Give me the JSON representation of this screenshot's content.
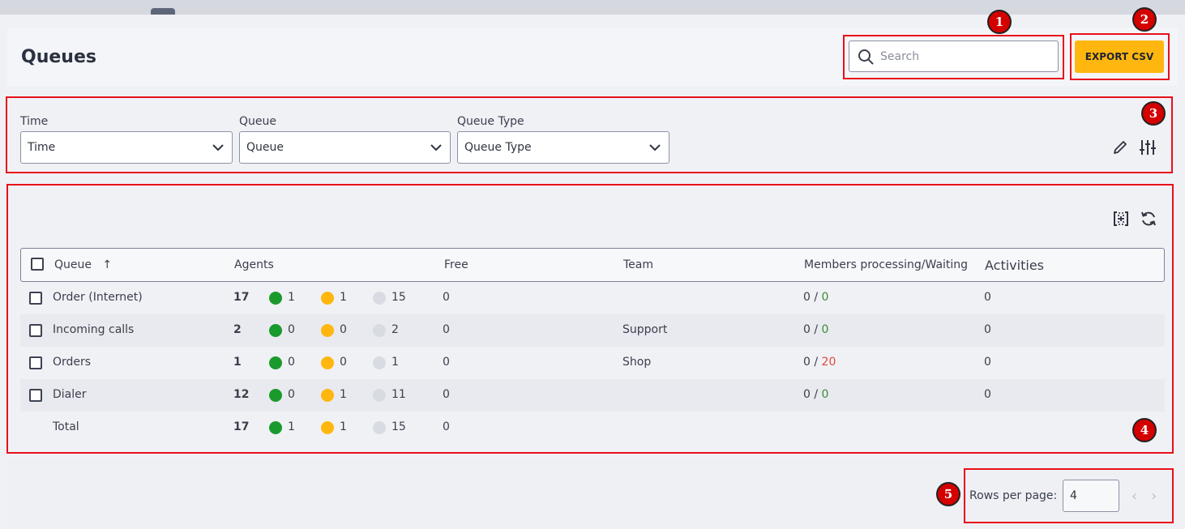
{
  "page": {
    "title": "Queues"
  },
  "search": {
    "placeholder": "Search",
    "value": ""
  },
  "export": {
    "label": "EXPORT CSV"
  },
  "filters": [
    {
      "label": "Time",
      "value": "Time"
    },
    {
      "label": "Queue",
      "value": "Queue"
    },
    {
      "label": "Queue Type",
      "value": "Queue Type"
    }
  ],
  "table": {
    "columns": {
      "queue": "Queue",
      "sort_indicator": "↑",
      "agents": "Agents",
      "free": "Free",
      "team": "Team",
      "members": "Members processing/Waiting",
      "activities": "Activities"
    },
    "rows": [
      {
        "name": "Order (Internet)",
        "agents_total": "17",
        "agents_green": "1",
        "agents_yellow": "1",
        "agents_grey": "15",
        "free": "0",
        "team": "",
        "processing": "0",
        "sep": "/",
        "waiting": "0",
        "activities": "0"
      },
      {
        "name": "Incoming calls",
        "agents_total": "2",
        "agents_green": "0",
        "agents_yellow": "0",
        "agents_grey": "2",
        "free": "0",
        "team": "Support",
        "processing": "0",
        "sep": "/",
        "waiting": "0",
        "activities": "0"
      },
      {
        "name": "Orders",
        "agents_total": "1",
        "agents_green": "0",
        "agents_yellow": "0",
        "agents_grey": "1",
        "free": "0",
        "team": "Shop",
        "processing": "0",
        "sep": "/",
        "waiting": "20",
        "activities": "0"
      },
      {
        "name": "Dialer",
        "agents_total": "12",
        "agents_green": "0",
        "agents_yellow": "1",
        "agents_grey": "11",
        "free": "0",
        "team": "",
        "processing": "0",
        "sep": "/",
        "waiting": "0",
        "activities": "0"
      }
    ],
    "total": {
      "name": "Total",
      "agents_total": "17",
      "agents_green": "1",
      "agents_yellow": "1",
      "agents_grey": "15",
      "free": "0"
    }
  },
  "pagination": {
    "rows_per_page_label": "Rows per page:",
    "rows_per_page": "4",
    "prev": "‹",
    "next": "›"
  },
  "annotations": [
    "1",
    "2",
    "3",
    "4",
    "5"
  ],
  "colors": {
    "accent": "#ffb70f",
    "status_active": "#1a9a2c",
    "status_busy": "#ffb70f",
    "status_offline": "#d8dbe2",
    "waiting_alert": "#e0483a",
    "highlight": "#e8101a"
  },
  "icons": [
    "search-icon",
    "chevron-down-icon",
    "pencil-icon",
    "sliders-icon",
    "column-settings-icon",
    "refresh-icon",
    "sort-ascending-icon",
    "chevron-left-icon",
    "chevron-right-icon"
  ]
}
